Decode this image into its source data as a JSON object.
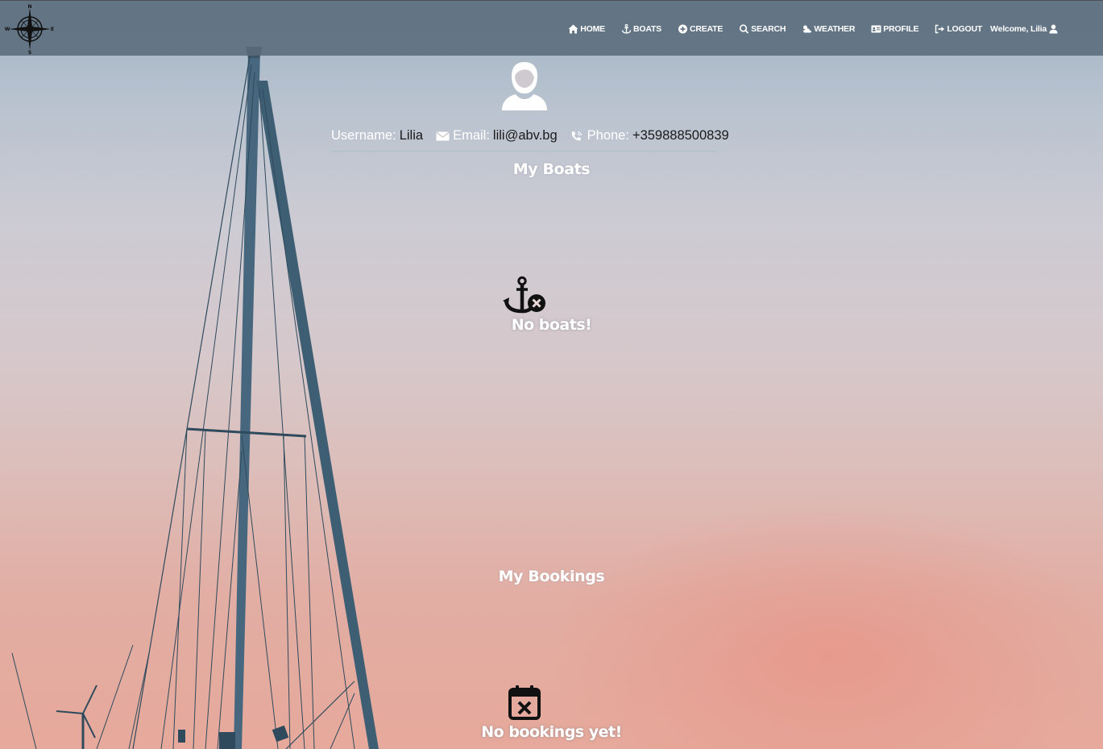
{
  "navbar": {
    "logo_compass_letters": [
      "N",
      "E",
      "S",
      "W"
    ],
    "links": [
      {
        "label": "HOME",
        "icon": "home-icon"
      },
      {
        "label": "BOATS",
        "icon": "anchor-icon"
      },
      {
        "label": "CREATE",
        "icon": "plus-circle-icon"
      },
      {
        "label": "SEARCH",
        "icon": "search-icon"
      },
      {
        "label": "WEATHER",
        "icon": "cloud-sun-icon"
      },
      {
        "label": "PROFILE",
        "icon": "id-card-icon"
      },
      {
        "label": "LOGOUT",
        "icon": "sign-out-icon"
      }
    ],
    "welcome": "Welcome, Lilia"
  },
  "profile": {
    "username_label": "Username:",
    "username": "Lilia",
    "email_label": "Email:",
    "email": "lili@abv.bg",
    "phone_label": "Phone:",
    "phone": "+359888500839"
  },
  "boats": {
    "title": "My Boats",
    "empty_text": "No boats!"
  },
  "bookings": {
    "title": "My Bookings",
    "empty_text": "No bookings yet!"
  },
  "colors": {
    "navbar_bg": "#5a6c7c",
    "text_light": "#ffffff",
    "text_dark": "#1a1a1a",
    "sky_top": "#9fb2c3",
    "sky_bottom": "#e6a99b"
  }
}
